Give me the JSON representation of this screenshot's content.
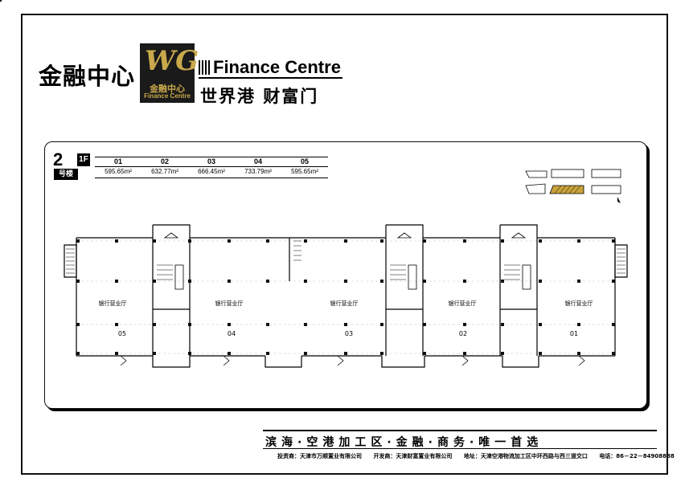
{
  "brand": {
    "name_cn": "金融中心",
    "logo_mark": "WG",
    "logo_cn": "金融中心",
    "logo_en": "Finance Centre",
    "title_en": "Finance Centre",
    "title_cn": "世界港  财富门"
  },
  "floor": {
    "building_number": "2",
    "building_label": "号楼",
    "floor_label": "1F"
  },
  "units": [
    {
      "code": "01",
      "area": "595.65m²"
    },
    {
      "code": "02",
      "area": "632.77m²"
    },
    {
      "code": "03",
      "area": "666.45m²"
    },
    {
      "code": "04",
      "area": "733.79m²"
    },
    {
      "code": "05",
      "area": "595.65m²"
    }
  ],
  "plan": {
    "room_names": [
      "银行营业厅",
      "银行营业厅",
      "银行营业厅",
      "银行营业厅",
      "银行营业厅"
    ],
    "room_numbers": [
      "05",
      "04",
      "03",
      "02",
      "01"
    ],
    "colors": {
      "line": "#000000",
      "grid": "#999999",
      "column": "#111111",
      "hatch": "#c8a23a"
    }
  },
  "footer": {
    "slogan": "滨海·空港加工区·金融·商务·唯一首选",
    "investor": "投资商：天津市万顺置业有限公司",
    "developer": "开发商：天津财富置业有限公司",
    "address": "地址：天津空港物流加工区中环西路与西三道交口",
    "phone": "电话：86－22－84908888"
  }
}
